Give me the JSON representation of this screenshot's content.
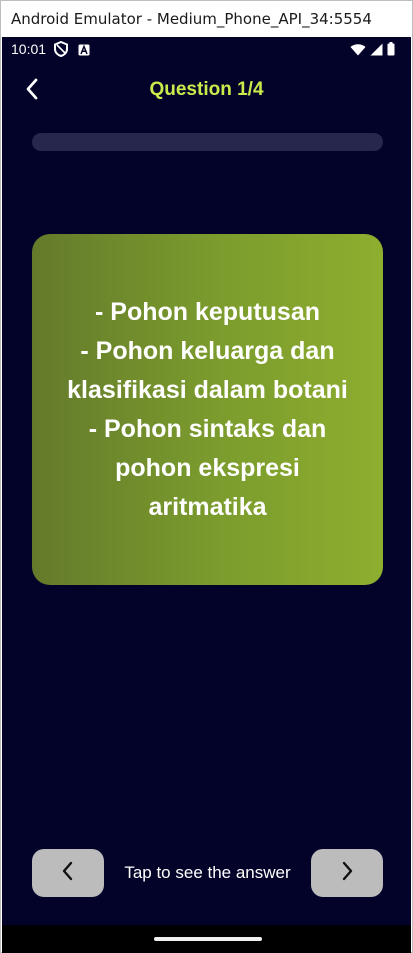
{
  "window": {
    "title": "Android Emulator - Medium_Phone_API_34:5554"
  },
  "status_bar": {
    "time": "10:01",
    "icons_left": [
      "shield-icon",
      "a-badge-icon"
    ],
    "icons_right": [
      "wifi-icon",
      "signal-icon",
      "battery-icon"
    ]
  },
  "app_bar": {
    "title": "Question 1/4",
    "back_icon": "chevron-left-icon"
  },
  "progress": {
    "value": 0.0
  },
  "card": {
    "text": "- Pohon keputusan\n- Pohon keluarga dan klasifikasi dalam botani\n- Pohon sintaks dan pohon ekspresi aritmatika"
  },
  "bottom": {
    "hint": "Tap to see the answer",
    "prev_icon": "chevron-left-icon",
    "next_icon": "chevron-right-icon"
  },
  "colors": {
    "background": "#03032a",
    "accent": "#c8ec4a",
    "card_start": "#647a2b",
    "card_end": "#8eae2f",
    "nav_button": "#bcbcbc"
  }
}
